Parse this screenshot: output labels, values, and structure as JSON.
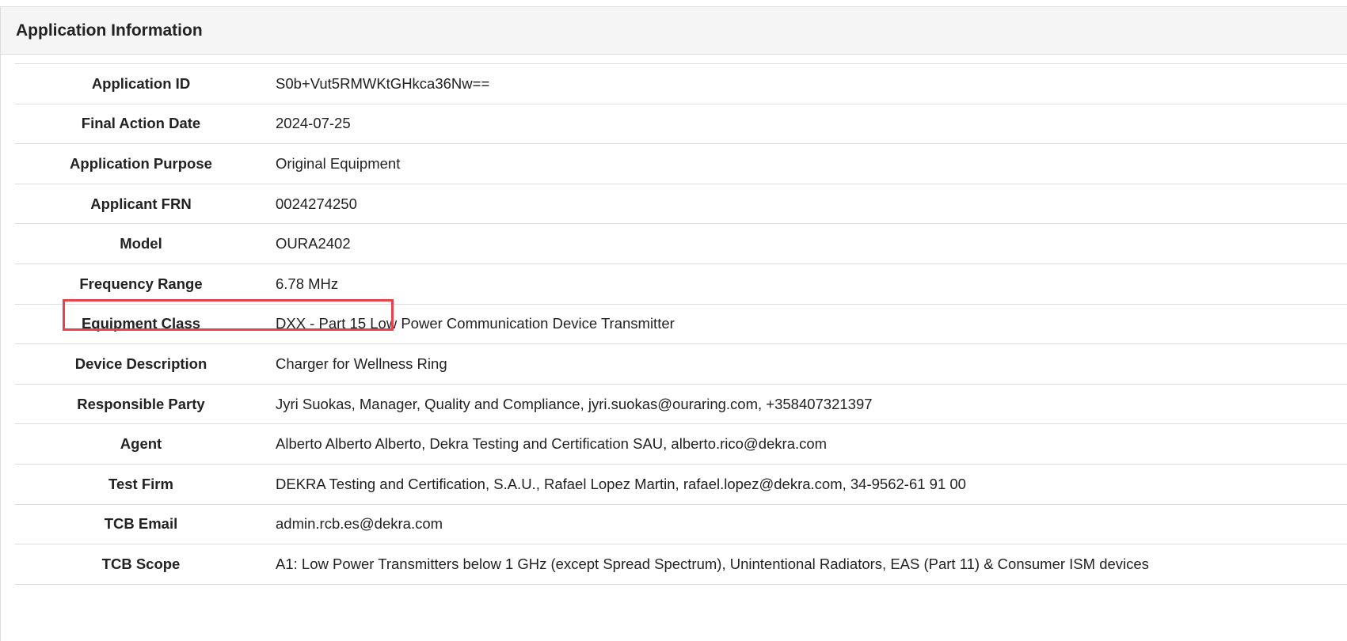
{
  "panel": {
    "title": "Application Information"
  },
  "rows": [
    {
      "label": "Application ID",
      "value": "S0b+Vut5RMWKtGHkca36Nw=="
    },
    {
      "label": "Final Action Date",
      "value": "2024-07-25"
    },
    {
      "label": "Application Purpose",
      "value": "Original Equipment"
    },
    {
      "label": "Applicant FRN",
      "value": "0024274250"
    },
    {
      "label": "Model",
      "value": "OURA2402"
    },
    {
      "label": "Frequency Range",
      "value": "6.78 MHz"
    },
    {
      "label": "Equipment Class",
      "value": "DXX - Part 15 Low Power Communication Device Transmitter"
    },
    {
      "label": "Device Description",
      "value": "Charger for Wellness Ring"
    },
    {
      "label": "Responsible Party",
      "value": "Jyri Suokas, Manager, Quality and Compliance, jyri.suokas@ouraring.com, +358407321397"
    },
    {
      "label": "Agent",
      "value": "Alberto Alberto Alberto, Dekra Testing and Certification SAU, alberto.rico@dekra.com"
    },
    {
      "label": "Test Firm",
      "value": "DEKRA Testing and Certification, S.A.U., Rafael Lopez Martin, rafael.lopez@dekra.com, 34-9562-61 91 00"
    },
    {
      "label": "TCB Email",
      "value": "admin.rcb.es@dekra.com"
    },
    {
      "label": "TCB Scope",
      "value": "A1: Low Power Transmitters below 1 GHz (except Spread Spectrum), Unintentional Radiators, EAS (Part 11) & Consumer ISM devices"
    }
  ],
  "highlight": {
    "row_label": "Frequency Range",
    "color": "#e8434b"
  }
}
